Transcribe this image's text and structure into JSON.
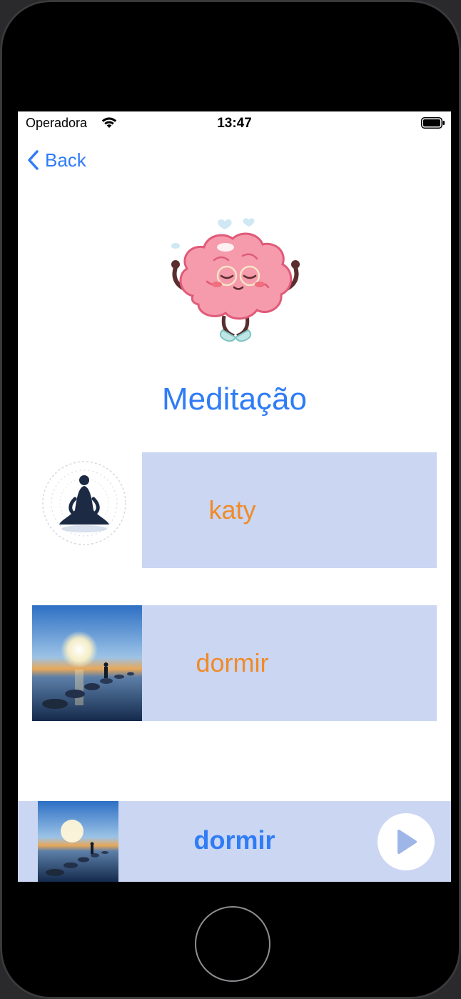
{
  "status_bar": {
    "carrier": "Operadora",
    "time": "13:47",
    "icons": [
      "wifi-icon",
      "battery-icon"
    ]
  },
  "nav": {
    "back_label": "Back",
    "back_icon": "chevron-left-icon"
  },
  "header": {
    "illustration": "meditating-brain-illustration",
    "title": "Meditação"
  },
  "meditations": [
    {
      "label": "katy",
      "thumbnail": "meditation-silhouette-mandala"
    },
    {
      "label": "dormir",
      "thumbnail": "sunset-stepping-stones"
    }
  ],
  "player": {
    "title": "dormir",
    "thumbnail": "sunset-stepping-stones",
    "play_icon": "play-icon"
  },
  "colors": {
    "accent": "#2f7cf6",
    "panel": "#cad6f2",
    "label": "#f08a28"
  }
}
